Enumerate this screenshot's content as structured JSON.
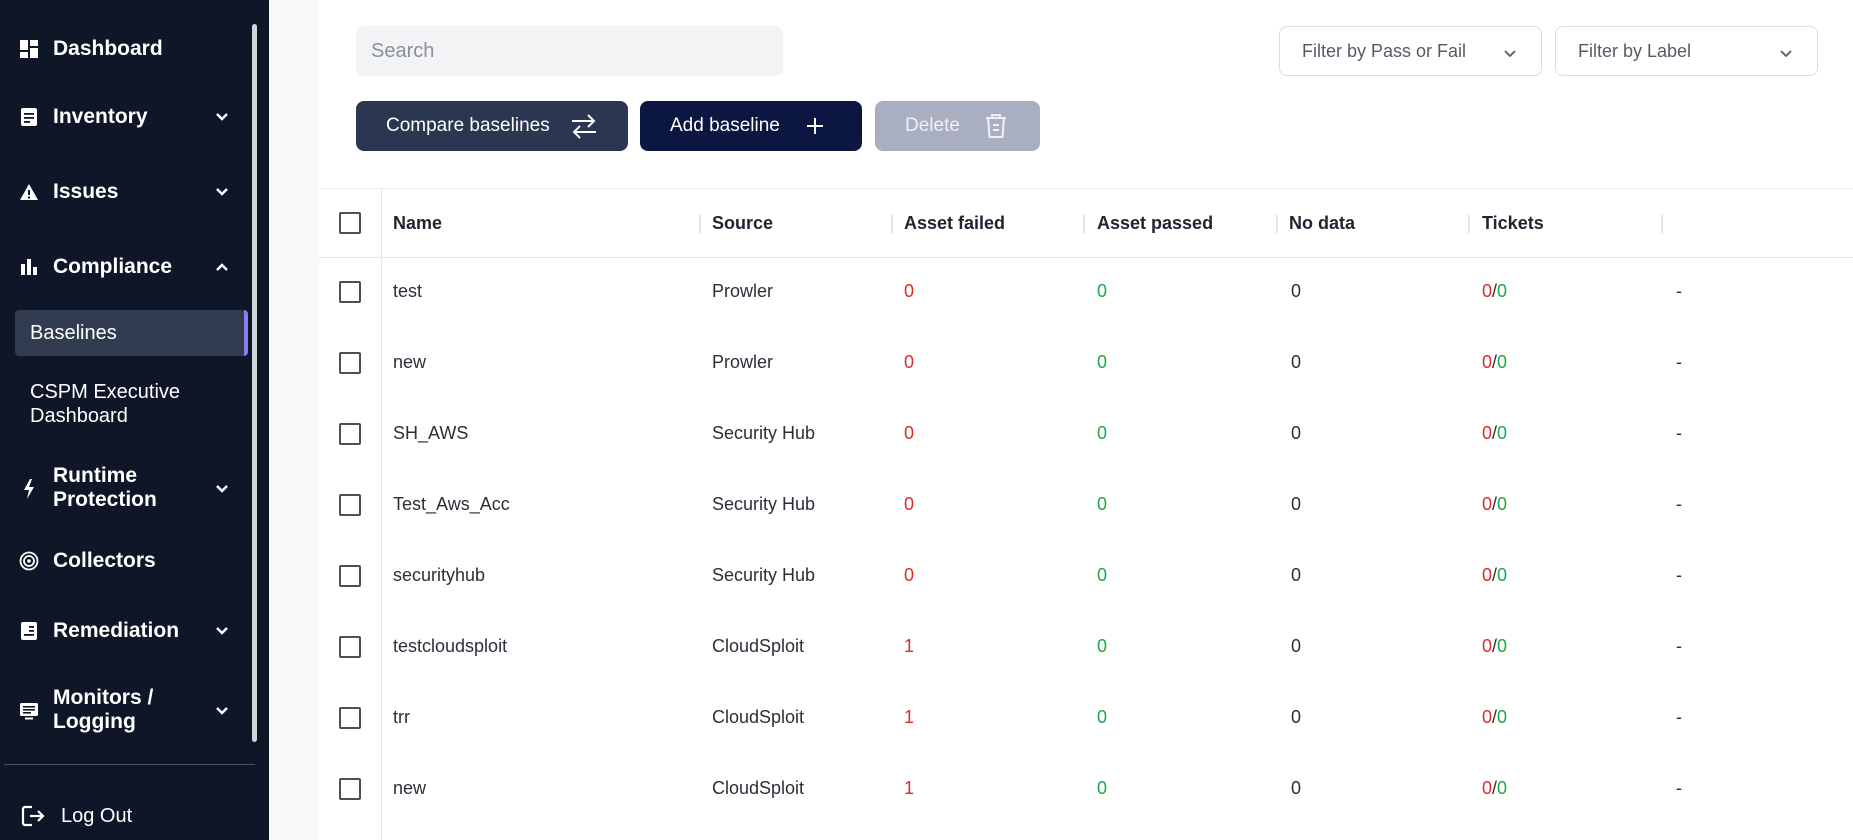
{
  "sidebar": {
    "items": [
      {
        "label": "Dashboard",
        "icon": "dashboard-icon"
      },
      {
        "label": "Inventory",
        "icon": "inventory-icon"
      },
      {
        "label": "Issues",
        "icon": "warning-icon"
      },
      {
        "label": "Compliance",
        "icon": "bar-chart-icon"
      },
      {
        "label": "Runtime Protection",
        "icon": "lightning-icon"
      },
      {
        "label": "Collectors",
        "icon": "target-icon"
      },
      {
        "label": "Remediation",
        "icon": "document-icon"
      },
      {
        "label": "Monitors / Logging",
        "icon": "monitor-icon"
      }
    ],
    "compliance_sub": [
      {
        "label": "Baselines"
      },
      {
        "label": "CSPM Executive Dashboard"
      }
    ],
    "logout_label": "Log Out"
  },
  "toolbar": {
    "search_placeholder": "Search",
    "filter_pass_fail": "Filter by Pass or Fail",
    "filter_label": "Filter by Label",
    "compare_label": "Compare baselines",
    "add_label": "Add baseline",
    "delete_label": "Delete"
  },
  "table": {
    "columns": [
      "Name",
      "Source",
      "Asset failed",
      "Asset passed",
      "No data",
      "Tickets"
    ],
    "rows": [
      {
        "name": "test",
        "source": "Prowler",
        "failed": "0",
        "passed": "0",
        "nodata": "0",
        "tickets_failed": "0",
        "tickets_passed": "0",
        "extra": "-"
      },
      {
        "name": "new",
        "source": "Prowler",
        "failed": "0",
        "passed": "0",
        "nodata": "0",
        "tickets_failed": "0",
        "tickets_passed": "0",
        "extra": "-"
      },
      {
        "name": "SH_AWS",
        "source": "Security Hub",
        "failed": "0",
        "passed": "0",
        "nodata": "0",
        "tickets_failed": "0",
        "tickets_passed": "0",
        "extra": "-"
      },
      {
        "name": "Test_Aws_Acc",
        "source": "Security Hub",
        "failed": "0",
        "passed": "0",
        "nodata": "0",
        "tickets_failed": "0",
        "tickets_passed": "0",
        "extra": "-"
      },
      {
        "name": "securityhub",
        "source": "Security Hub",
        "failed": "0",
        "passed": "0",
        "nodata": "0",
        "tickets_failed": "0",
        "tickets_passed": "0",
        "extra": "-"
      },
      {
        "name": "testcloudsploit",
        "source": "CloudSploit",
        "failed": "1",
        "passed": "0",
        "nodata": "0",
        "tickets_failed": "0",
        "tickets_passed": "0",
        "extra": "-"
      },
      {
        "name": "trr",
        "source": "CloudSploit",
        "failed": "1",
        "passed": "0",
        "nodata": "0",
        "tickets_failed": "0",
        "tickets_passed": "0",
        "extra": "-"
      },
      {
        "name": "new",
        "source": "CloudSploit",
        "failed": "1",
        "passed": "0",
        "nodata": "0",
        "tickets_failed": "0",
        "tickets_passed": "0",
        "extra": "-"
      }
    ],
    "ticket_separator": "/"
  },
  "colors": {
    "sidebar_bg": "#0e1628",
    "accent": "#8b7cf6",
    "fail": "#e02a2a",
    "pass": "#1fa64a"
  }
}
